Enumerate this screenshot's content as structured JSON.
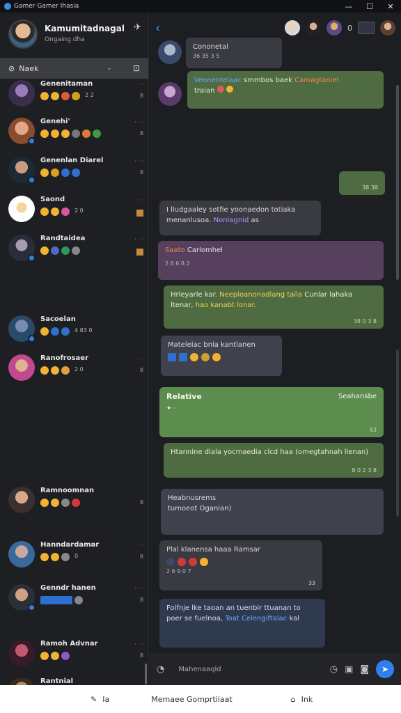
{
  "window": {
    "title": "Gamer Gamer Ihasia",
    "minimize": "—",
    "maximize": "☐",
    "close": "✕"
  },
  "profile": {
    "name": "Kamumitadnagal",
    "status": "Ongaing dha",
    "pin_icon": "pin-icon"
  },
  "search": {
    "placeholder": "Naek",
    "chevron": "⌄",
    "find_icon": "⊡"
  },
  "contacts": [
    {
      "name": "Genenitaman",
      "time": "· ·",
      "extra": "2 2",
      "meta": "8",
      "color": "#7a6a8c"
    },
    {
      "name": "Genehi'",
      "time": "· · ·",
      "extra": "",
      "meta": "8",
      "color": "#b07a5e"
    },
    {
      "name": "Genenlan Diarel",
      "time": "· · ·",
      "extra": "",
      "meta": "8",
      "color": "#56697a"
    },
    {
      "name": "Saond",
      "time": "· ·",
      "extra": "2 0",
      "meta": "",
      "color": "#e8e3d8"
    },
    {
      "name": "Randtaidea",
      "time": "· · ·",
      "extra": "",
      "meta": "",
      "color": "#4a4f59"
    },
    {
      "name": "Sacoelan",
      "time": "",
      "extra": "4 83 0",
      "meta": "",
      "color": "#3f6b8a"
    },
    {
      "name": "Ranofrosaer",
      "time": "· ·",
      "extra": "2 0",
      "meta": "8",
      "color": "#c05c8a"
    },
    {
      "name": "Ramnoomnan",
      "time": "",
      "extra": "",
      "meta": "8",
      "color": "#6a5c54"
    },
    {
      "name": "Hanndardamar",
      "time": "· ·",
      "extra": "0",
      "meta": "8",
      "color": "#5a7a9a"
    },
    {
      "name": "Genndr hanen",
      "time": "· · ·",
      "extra": "",
      "meta": "8",
      "color": "#3a4a5a"
    },
    {
      "name": "Ramoh Advnar",
      "time": "· · ·",
      "extra": "",
      "meta": "8",
      "color": "#8a3b4a"
    },
    {
      "name": "Rantnial",
      "time": "",
      "extra": "",
      "meta": "",
      "color": "#7a5a3a"
    }
  ],
  "header": {
    "back_icon": "‹",
    "member_count": "0"
  },
  "messages": [
    {
      "text": "Cononetal",
      "time": "36 35 3 5"
    },
    {
      "text_a": "Veonentelaac",
      "text_b": " smmbos baek ",
      "text_c": "Camagtaniel ",
      "text_d": "traian"
    },
    {
      "time": "38 38"
    },
    {
      "text_a": "I lludgaaley sotfie yoonaedon totiaka menanlusoa. ",
      "text_b": "Nonlagnid",
      "text_c": " as"
    },
    {
      "title": "Saato",
      "title_b": " Carlomhel",
      "time": "2 6 6 8 2"
    },
    {
      "text_a": "Hrleyarle kar. ",
      "text_b": "Neeploanonadlang taila ",
      "text_c": "Cunlar lahaka ",
      "text_d": "ltenar, ",
      "text_e": "hao kanabt lonar.",
      "time": "38 0 3 8"
    },
    {
      "text": "Matelelac bnla kantlanen"
    },
    {
      "title": "Relative",
      "right": "Seahansbe",
      "time": "83"
    },
    {
      "text": "Htannine dlala yocmaedia clcd haa (omegtahnah llenan)",
      "time": "8 0 2 3 8"
    },
    {
      "text_a": "Heabnusrems",
      "text_b": "tumoeot Oganian)"
    },
    {
      "text": "Plal klanensa haaa Ramsar",
      "time": "2 6 9 0 7",
      "time_r": "33"
    },
    {
      "text_a": "Folfnje lke taoan an tuenbir ttuanan to poer se fuelnoa, ",
      "text_b": "Toat Celengiftalac",
      "text_c": " kal"
    }
  ],
  "composer": {
    "placeholder": "Mahenaaqld"
  },
  "bottombar": {
    "item1": "Ia",
    "item2": "Memaee Gomprtiiaat",
    "item3": "Ink"
  }
}
